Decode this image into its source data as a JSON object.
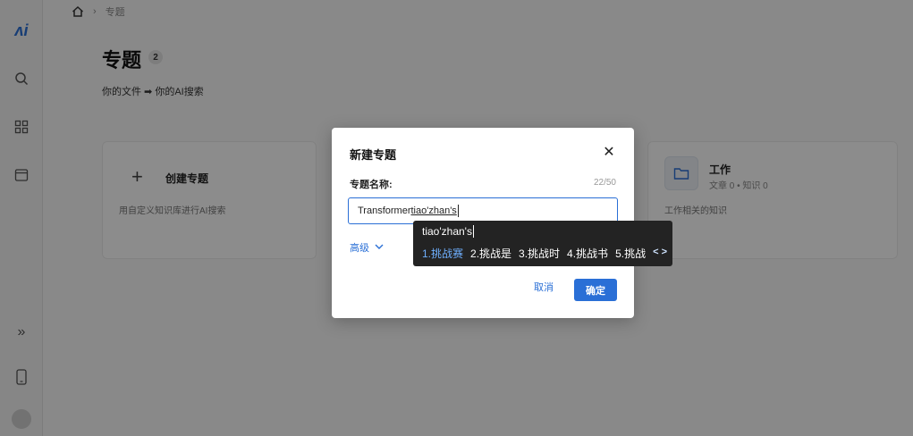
{
  "sidebar": {
    "logo": "ʌi",
    "expand_icon": "»"
  },
  "breadcrumb": {
    "current": "专题"
  },
  "page": {
    "title": "专题",
    "count": "2",
    "subtitle": "你的文件 ➡ 你的AI搜索"
  },
  "create_card": {
    "title": "创建专题",
    "description": "用自定义知识库进行AI搜索"
  },
  "topic_card": {
    "title": "工作",
    "meta": "文章 0 • 知识 0",
    "description": "工作相关的知识"
  },
  "modal": {
    "title": "新建专题",
    "field_label": "专题名称:",
    "char_count": "22/50",
    "input_value_committed": "Transformer",
    "input_value_composing": "tiao'zhan's",
    "advanced_label": "高级",
    "cancel_label": "取消",
    "confirm_label": "确定"
  },
  "ime": {
    "composition": "tiao'zhan's",
    "candidates": [
      "1.挑战赛",
      "2.挑战是",
      "3.挑战时",
      "4.挑战书",
      "5.挑战"
    ],
    "selected_index": 0,
    "nav": "< >"
  },
  "colors": {
    "accent": "#2a6fd6",
    "ime_background": "#232323",
    "ime_selected": "#6fb0ff"
  }
}
